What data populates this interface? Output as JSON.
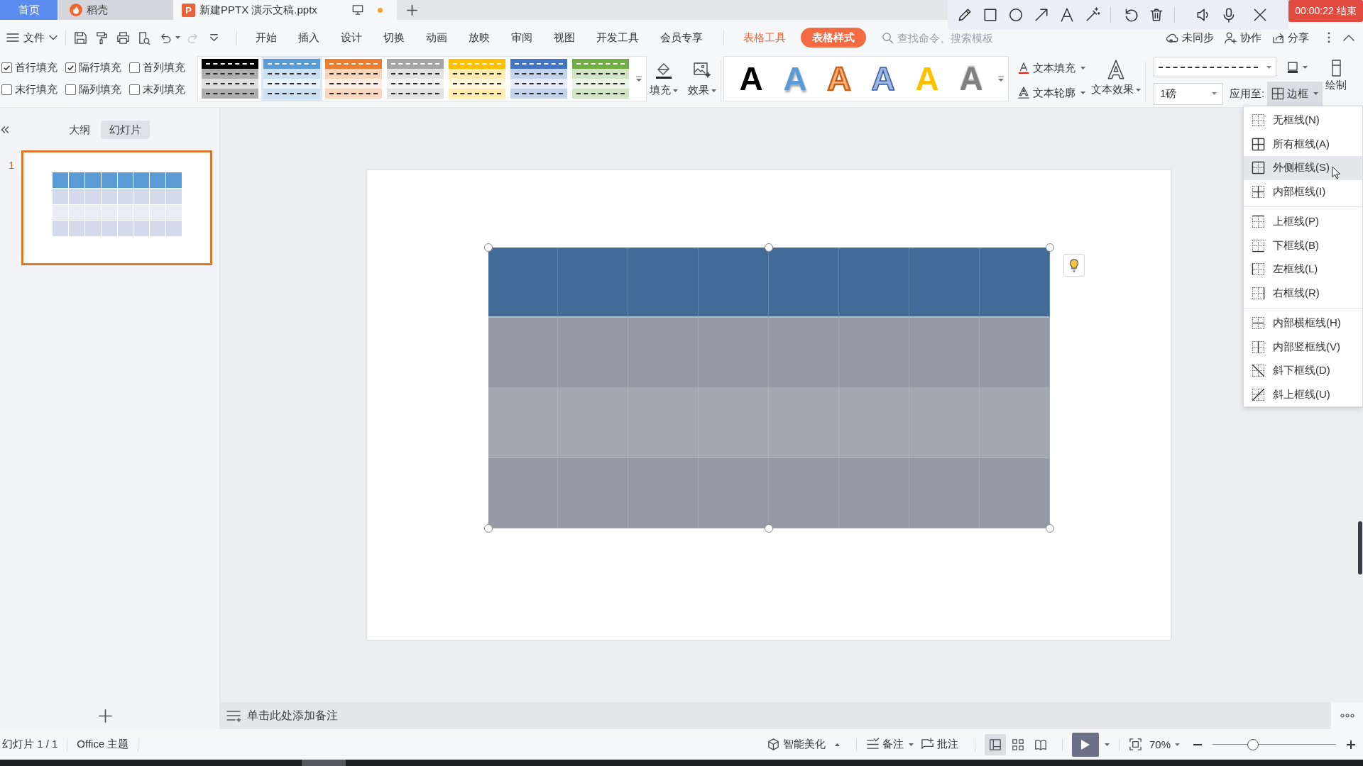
{
  "tabs": [
    {
      "label": "首页",
      "kind": "home",
      "selected": false
    },
    {
      "label": "稻壳",
      "kind": "docer",
      "selected": false
    },
    {
      "label": "新建PPTX 演示文稿.pptx",
      "kind": "document",
      "selected": true,
      "icon_letter": "P",
      "unsaved": true
    }
  ],
  "recorder": {
    "time": "00:00:22",
    "stop_label": "结束"
  },
  "menu_bar": {
    "file_label": "文件",
    "quick_access": [
      {
        "kind": "save",
        "disabled": false
      },
      {
        "kind": "roller",
        "disabled": false
      },
      {
        "kind": "print",
        "disabled": false
      },
      {
        "kind": "preview",
        "disabled": false
      },
      {
        "kind": "undo",
        "disabled": false
      },
      {
        "kind": "redo",
        "disabled": true
      },
      {
        "kind": "customize",
        "disabled": false
      }
    ],
    "tabs": [
      {
        "label": "开始",
        "kind": "standard",
        "selected": false
      },
      {
        "label": "插入",
        "kind": "standard",
        "selected": false
      },
      {
        "label": "设计",
        "kind": "standard",
        "selected": false
      },
      {
        "label": "切换",
        "kind": "standard",
        "selected": false
      },
      {
        "label": "动画",
        "kind": "standard",
        "selected": false
      },
      {
        "label": "放映",
        "kind": "standard",
        "selected": false
      },
      {
        "label": "审阅",
        "kind": "standard",
        "selected": false
      },
      {
        "label": "视图",
        "kind": "standard",
        "selected": false
      },
      {
        "label": "开发工具",
        "kind": "standard",
        "selected": false
      },
      {
        "label": "会员专享",
        "kind": "standard",
        "selected": false
      },
      {
        "label": "表格工具",
        "kind": "context",
        "selected": false
      },
      {
        "label": "表格样式",
        "kind": "context",
        "selected": true
      }
    ],
    "search": {
      "placeholder": "查找命令、搜索模板"
    },
    "actions": [
      {
        "label": "未同步",
        "kind": "sync"
      },
      {
        "label": "协作",
        "kind": "collaborate"
      },
      {
        "label": "分享",
        "kind": "share"
      }
    ]
  },
  "ribbon": {
    "options": [
      {
        "label": "首行填充",
        "checked": true
      },
      {
        "label": "隔行填充",
        "checked": true
      },
      {
        "label": "首列填充",
        "checked": false
      },
      {
        "label": "末行填充",
        "checked": false
      },
      {
        "label": "隔列填充",
        "checked": false
      },
      {
        "label": "末列填充",
        "checked": false
      }
    ],
    "table_styles": [
      {
        "color": "#000000",
        "selected": false
      },
      {
        "color": "#5b9bd5",
        "selected": true
      },
      {
        "color": "#ed7d31",
        "selected": false
      },
      {
        "color": "#a5a5a5",
        "selected": false
      },
      {
        "color": "#ffc000",
        "selected": false
      },
      {
        "color": "#4472c4",
        "selected": false
      },
      {
        "color": "#70ad47",
        "selected": false
      }
    ],
    "fill_label": "填充",
    "effect_label": "效果",
    "text_styles": [
      {
        "label": "A",
        "kind": "solid",
        "color": "#000000"
      },
      {
        "label": "A",
        "kind": "shadow",
        "color": "#5b9bd5"
      },
      {
        "label": "A",
        "kind": "soft-outline",
        "color": "#f4b183"
      },
      {
        "label": "A",
        "kind": "outline",
        "color": "#9fb6e0"
      },
      {
        "label": "A",
        "kind": "solid",
        "color": "#ffc000"
      },
      {
        "label": "A",
        "kind": "gradient",
        "color": "#808080"
      }
    ],
    "text_fill_label": "文本填充",
    "text_outline_label": "文本轮廓",
    "text_effect_label": "文本效果",
    "line_weight": "1磅",
    "apply_label": "应用至:",
    "border_button": {
      "label": "边框",
      "expanded": true
    },
    "draw_label": "绘制"
  },
  "border_menu": {
    "groups": [
      {
        "items": [
          {
            "label": "无框线(N)",
            "kind": "none",
            "hovered": false
          },
          {
            "label": "所有框线(A)",
            "kind": "all",
            "hovered": false
          },
          {
            "label": "外侧框线(S)",
            "kind": "outside",
            "hovered": true
          },
          {
            "label": "内部框线(I)",
            "kind": "inside",
            "hovered": false
          }
        ]
      },
      {
        "items": [
          {
            "label": "上框线(P)",
            "kind": "top",
            "hovered": false
          },
          {
            "label": "下框线(B)",
            "kind": "bottom",
            "hovered": false
          },
          {
            "label": "左框线(L)",
            "kind": "left",
            "hovered": false
          },
          {
            "label": "右框线(R)",
            "kind": "right",
            "hovered": false
          }
        ]
      },
      {
        "items": [
          {
            "label": "内部横框线(H)",
            "kind": "inside-h",
            "hovered": false
          },
          {
            "label": "内部竖框线(V)",
            "kind": "inside-v",
            "hovered": false
          },
          {
            "label": "斜下框线(D)",
            "kind": "diag-down",
            "hovered": false
          },
          {
            "label": "斜上框线(U)",
            "kind": "diag-up",
            "hovered": false
          }
        ]
      }
    ]
  },
  "left_panel": {
    "tabs": [
      {
        "label": "大纲",
        "selected": false
      },
      {
        "label": "幻灯片",
        "selected": true
      }
    ],
    "slides": [
      {
        "number": "1",
        "selected": true
      }
    ]
  },
  "slide": {
    "table": {
      "selected": true,
      "rows": [
        {
          "kind": "header"
        },
        {
          "kind": "band"
        },
        {
          "kind": "plain"
        },
        {
          "kind": "band"
        }
      ]
    }
  },
  "notes": {
    "placeholder": "单击此处添加备注"
  },
  "status_bar": {
    "slide_counter": "幻灯片 1 / 1",
    "theme": "Office 主题",
    "beautify_label": "智能美化",
    "notes_label": "备注",
    "comments_label": "批注",
    "views": [
      {
        "kind": "normal",
        "selected": true
      },
      {
        "kind": "sorter",
        "selected": false
      },
      {
        "kind": "reading",
        "selected": false
      }
    ],
    "zoom": "70%",
    "zoom_slider": {
      "level": 0.33
    }
  }
}
